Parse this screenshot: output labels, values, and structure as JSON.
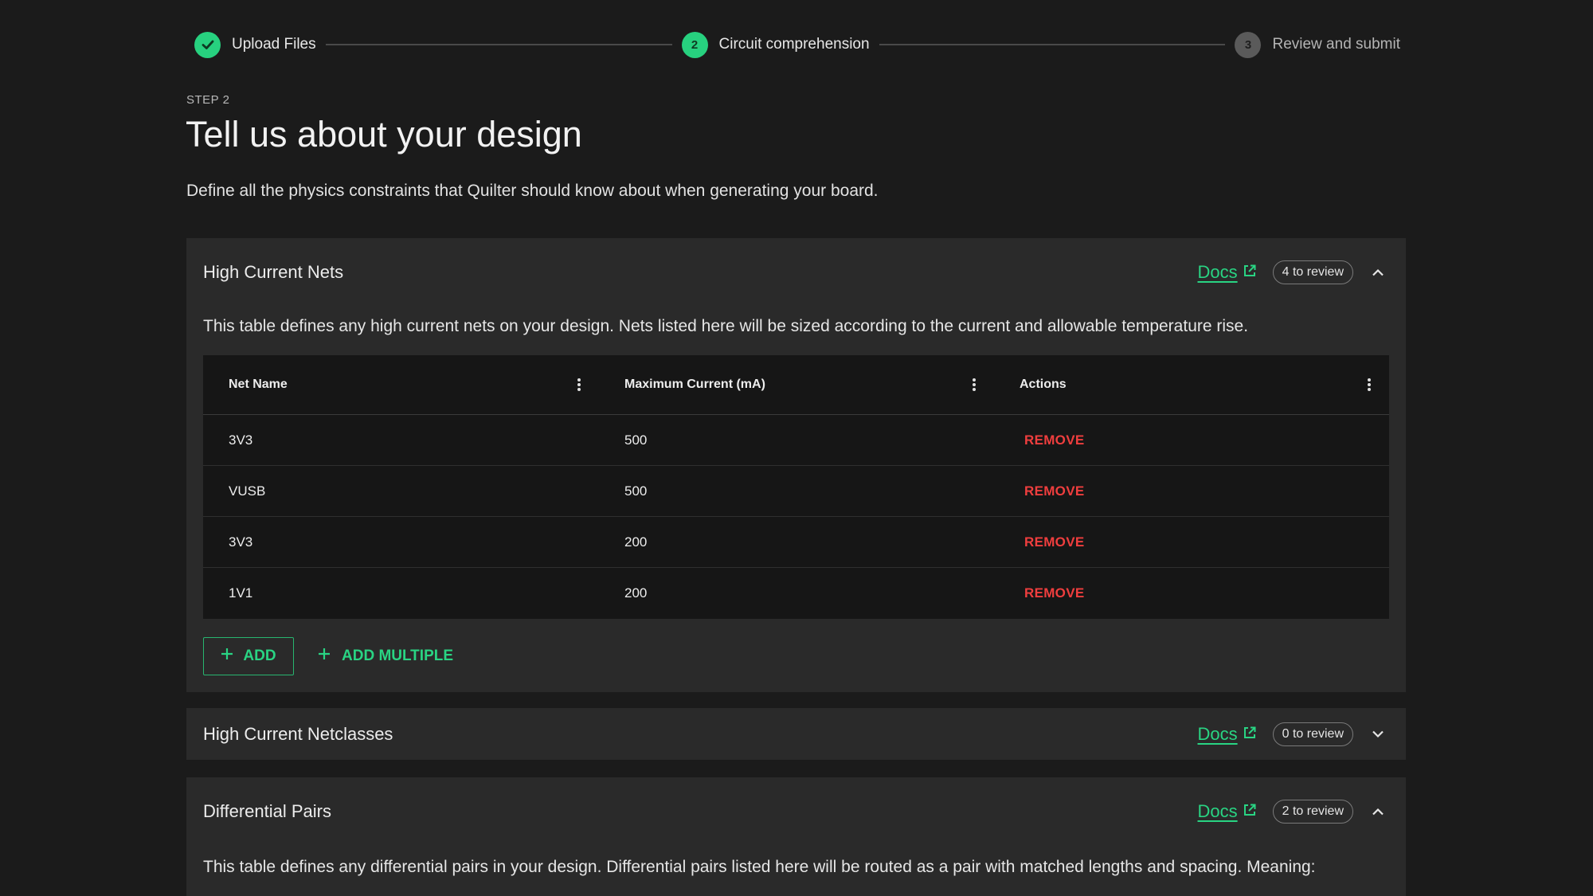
{
  "stepper": {
    "steps": [
      {
        "number": "",
        "label": "Upload Files",
        "state": "done"
      },
      {
        "number": "2",
        "label": "Circuit comprehension",
        "state": "active"
      },
      {
        "number": "3",
        "label": "Review and submit",
        "state": "pending"
      }
    ]
  },
  "header": {
    "eyebrow": "STEP 2",
    "title": "Tell us about your design",
    "subtitle": "Define all the physics constraints that Quilter should know about when generating your board."
  },
  "panels": [
    {
      "title": "High Current Nets",
      "docs_label": "Docs",
      "badge": "4 to review",
      "expanded": true,
      "description": "This table defines any high current nets on your design. Nets listed here will be sized according to the current and allowable temperature rise.",
      "table": {
        "columns": [
          "Net Name",
          "Maximum Current (mA)",
          "Actions"
        ],
        "rows": [
          {
            "net": "3V3",
            "current": "500",
            "action": "REMOVE"
          },
          {
            "net": "VUSB",
            "current": "500",
            "action": "REMOVE"
          },
          {
            "net": "3V3",
            "current": "200",
            "action": "REMOVE"
          },
          {
            "net": "1V1",
            "current": "200",
            "action": "REMOVE"
          }
        ]
      },
      "add_label": "ADD",
      "add_multiple_label": "ADD MULTIPLE"
    },
    {
      "title": "High Current Netclasses",
      "docs_label": "Docs",
      "badge": "0 to review",
      "expanded": false
    },
    {
      "title": "Differential Pairs",
      "docs_label": "Docs",
      "badge": "2 to review",
      "expanded": true,
      "description": "This table defines any differential pairs in your design. Differential pairs listed here will be routed as a pair with matched lengths and spacing. Meaning:"
    }
  ],
  "colors": {
    "background": "#1b1b1b",
    "panel": "#2a2a2a",
    "table": "#161616",
    "accent_green": "#29d483",
    "danger_red": "#ef3e3e"
  }
}
